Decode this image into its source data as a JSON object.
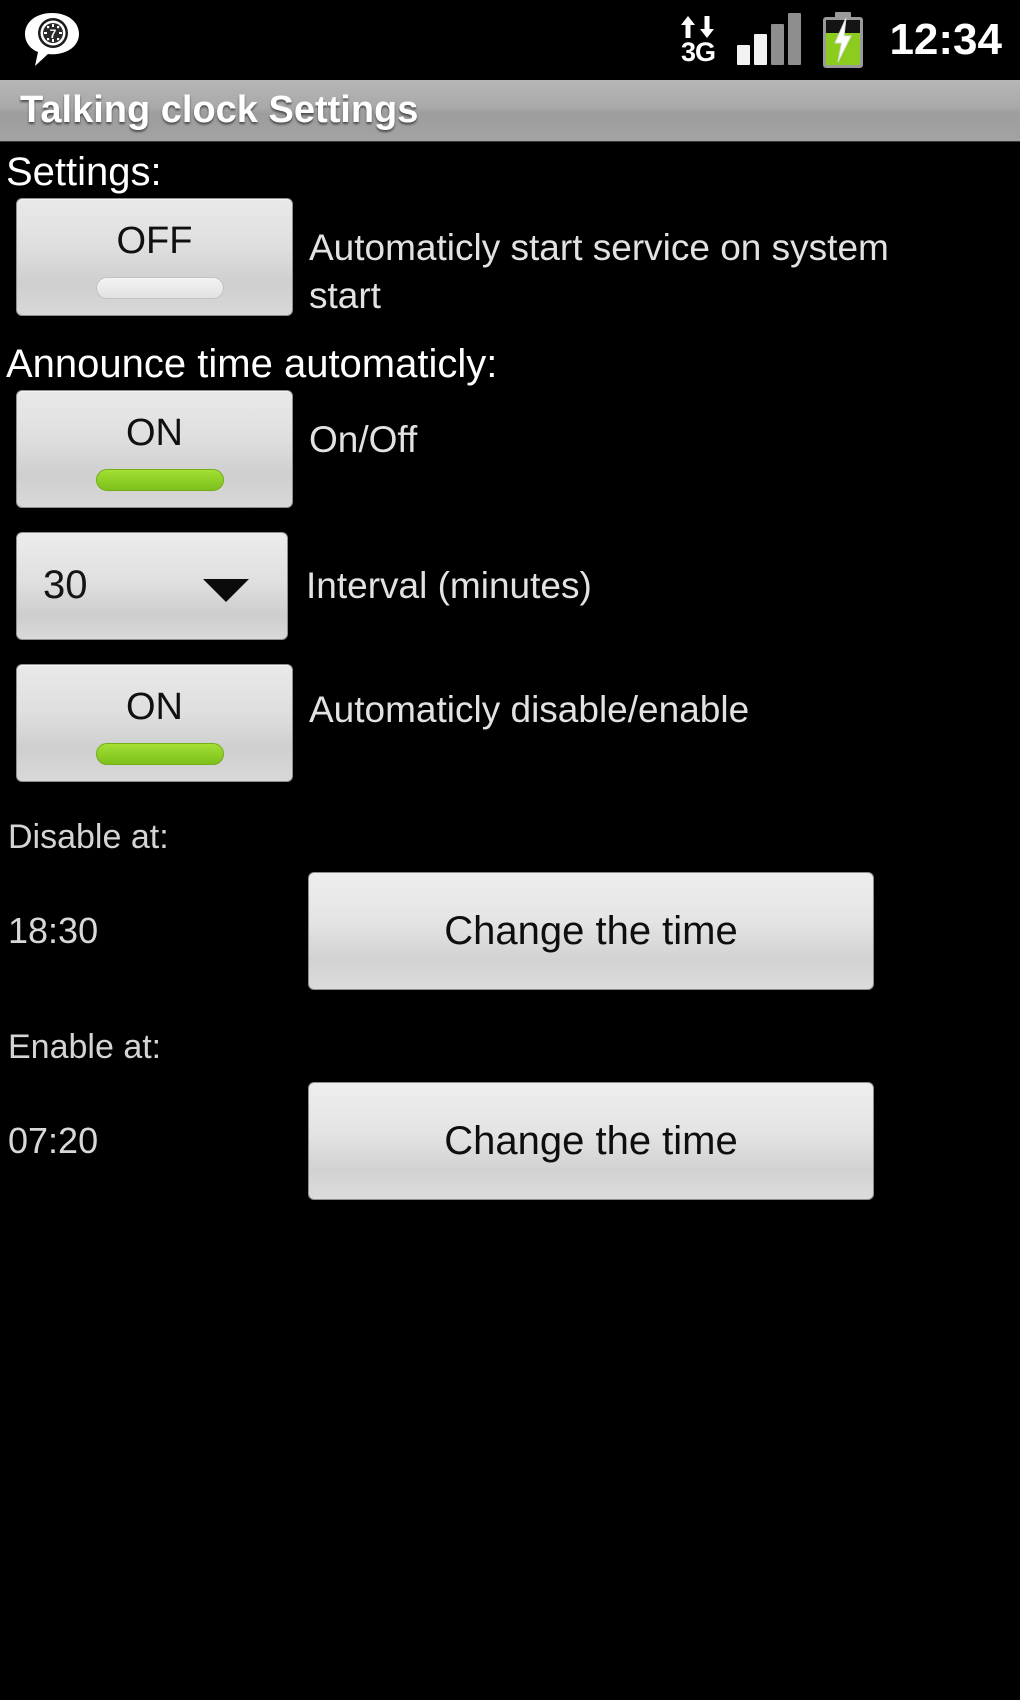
{
  "statusbar": {
    "notification_icon": "talking-clock-bubble-icon",
    "network_icon": "3g-data-icon",
    "network_label": "3G",
    "signal_icon": "signal-bars-icon",
    "signal_bars": 4,
    "battery_icon": "battery-charging-icon",
    "battery_color": "#8bcc1f",
    "clock": "12:34"
  },
  "titlebar": {
    "title": "Talking clock Settings"
  },
  "sections": {
    "settings_heading": "Settings:",
    "announce_heading": "Announce time automaticly:"
  },
  "autostart": {
    "toggle_state": "OFF",
    "label": "Automaticly start service on system start"
  },
  "announce_onoff": {
    "toggle_state": "ON",
    "label": "On/Off"
  },
  "interval": {
    "value": "30",
    "label": "Interval (minutes)",
    "arrow_icon": "chevron-down-icon"
  },
  "auto_disable": {
    "toggle_state": "ON",
    "label": "Automaticly disable/enable"
  },
  "disable_at": {
    "heading": "Disable at:",
    "time": "18:30",
    "button_label": "Change the time"
  },
  "enable_at": {
    "heading": "Enable at:",
    "time": "07:20",
    "button_label": "Change the time"
  }
}
